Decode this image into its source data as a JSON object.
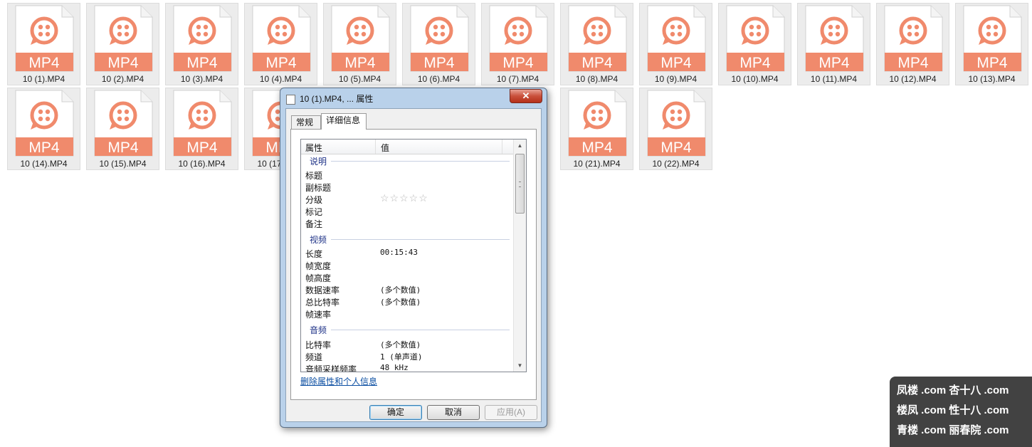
{
  "files": [
    "10 (1).MP4",
    "10 (2).MP4",
    "10 (3).MP4",
    "10 (4).MP4",
    "10 (5).MP4",
    "10 (6).MP4",
    "10 (7).MP4",
    "10 (8).MP4",
    "10 (9).MP4",
    "10 (10).MP4",
    "10 (11).MP4",
    "10 (12).MP4",
    "10 (13).MP4",
    "10 (14).MP4",
    "10 (15).MP4",
    "10 (16).MP4",
    "10 (17).MP4",
    "10 (21).MP4",
    "10 (22).MP4"
  ],
  "file_badge": "MP4",
  "file_icon": "video-file-icon",
  "colors": {
    "file_accent": "#f08a6c",
    "group_text": "#1e3287",
    "link": "#0b4ea2"
  },
  "dialog": {
    "title": "10 (1).MP4, ... 属性",
    "close_label": "✕",
    "tabs": [
      "常规",
      "详细信息"
    ],
    "active_tab": "详细信息",
    "columns": {
      "property": "属性",
      "value": "值"
    },
    "groups": {
      "description": "说明",
      "video": "视频",
      "audio": "音频"
    },
    "rows": {
      "title": "标题",
      "subtitle": "副标题",
      "rating": "分级",
      "rating_stars": "☆☆☆☆☆",
      "tags": "标记",
      "comments": "备注",
      "length": "长度",
      "length_value": "00:15:43",
      "frame_width": "帧宽度",
      "frame_height": "帧高度",
      "data_rate": "数据速率",
      "data_rate_value": "(多个数值)",
      "total_bitrate": "总比特率",
      "total_bitrate_value": "(多个数值)",
      "frame_rate": "帧速率",
      "bitrate": "比特率",
      "bitrate_value": "(多个数值)",
      "channels": "频道",
      "channels_value": "1 (单声道)",
      "sample_rate": "音频采样频率",
      "sample_rate_value": "48 kHz"
    },
    "remove_link": "删除属性和个人信息",
    "buttons": {
      "ok": "确定",
      "cancel": "取消",
      "apply": "应用(A)"
    }
  },
  "watermark": {
    "line1": "凤楼 .com  杏十八 .com",
    "line2": "楼凤 .com  性十八 .com",
    "line3": "青楼 .com  丽春院 .com"
  }
}
